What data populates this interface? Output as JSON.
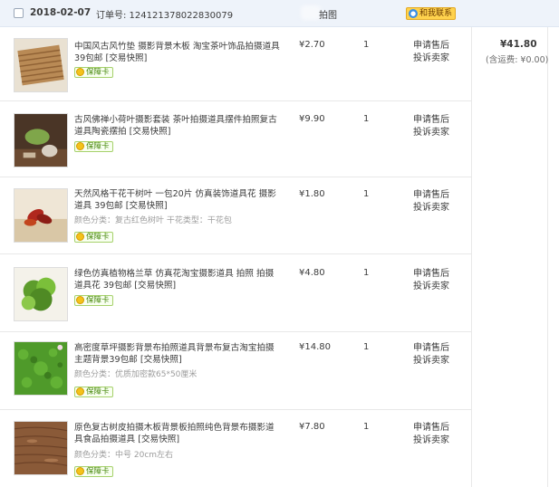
{
  "order": {
    "date": "2018-02-07",
    "order_no": "订单号: 124121378022830079",
    "shop": "拍图",
    "chat_label": "和我联系",
    "total": "¥41.80",
    "shipping": "(含运费: ¥0.00)"
  },
  "labels": {
    "badge": "保障卡",
    "apply_refund": "申请售后",
    "complain": "投诉卖家"
  },
  "items": [
    {
      "title": "中国风古风竹垫 摄影背景木板 淘宝茶叶饰品拍摄道具 39包邮",
      "snapshot": "[交易快照]",
      "props": "",
      "price": "¥2.70",
      "qty": "1"
    },
    {
      "title": "古风佛禅小荷叶摄影套装 茶叶拍摄道具摆件拍照复古道具陶瓷摆拍",
      "snapshot": "[交易快照]",
      "props": "",
      "price": "¥9.90",
      "qty": "1"
    },
    {
      "title": "天然风格干花干树叶 一包20片 仿真装饰道具花 摄影道具 39包邮",
      "snapshot": "[交易快照]",
      "props": "颜色分类：复古红色树叶  干花类型：干花包",
      "price": "¥1.80",
      "qty": "1"
    },
    {
      "title": "绿色仿真植物格兰草 仿真花淘宝摄影道具 拍照 拍摄道具花 39包邮",
      "snapshot": "[交易快照]",
      "props": "",
      "price": "¥4.80",
      "qty": "1"
    },
    {
      "title": "高密度草坪摄影背景布拍照道具背景布复古淘宝拍摄主题背景39包邮",
      "snapshot": "[交易快照]",
      "props": "颜色分类：优质加密款65*50厘米",
      "price": "¥14.80",
      "qty": "1"
    },
    {
      "title": "原色复古树皮拍摄木板背景板拍照纯色背景布摄影道具食品拍摄道具",
      "snapshot": "[交易快照]",
      "props": "颜色分类：中号 20cm左右",
      "price": "¥7.80",
      "qty": "1"
    }
  ]
}
